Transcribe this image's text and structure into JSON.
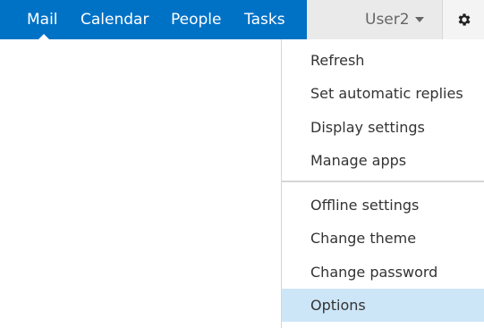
{
  "nav": {
    "items": [
      {
        "label": "Mail",
        "active": true
      },
      {
        "label": "Calendar"
      },
      {
        "label": "People"
      },
      {
        "label": "Tasks"
      }
    ],
    "accent_color": "#0072c6"
  },
  "user": {
    "name": "User2"
  },
  "settings_menu": {
    "groups": [
      {
        "items": [
          "Refresh",
          "Set automatic replies",
          "Display settings",
          "Manage apps"
        ]
      },
      {
        "items": [
          "Offline settings",
          "Change theme",
          "Change password",
          "Options"
        ]
      }
    ],
    "highlighted_item": "Options",
    "highlight_color": "#cde6f7"
  },
  "icons": {
    "settings": "gear-icon",
    "user_dropdown": "chevron-down-icon"
  }
}
